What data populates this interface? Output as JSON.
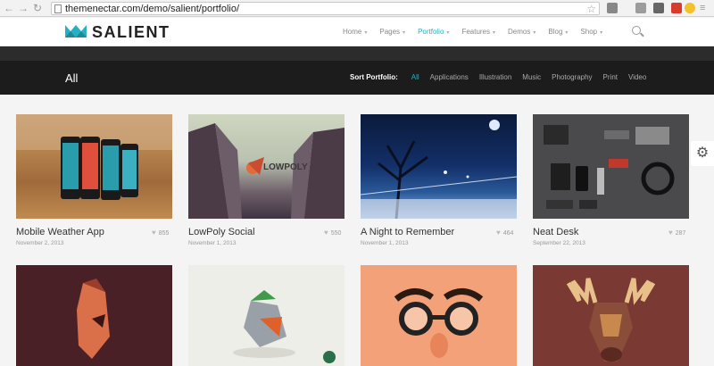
{
  "browser": {
    "url": "themenectar.com/demo/salient/portfolio/"
  },
  "header": {
    "logo_text": "SALIENT",
    "nav": [
      {
        "label": "Home",
        "active": false
      },
      {
        "label": "Pages",
        "active": false
      },
      {
        "label": "Portfolio",
        "active": true
      },
      {
        "label": "Features",
        "active": false
      },
      {
        "label": "Demos",
        "active": false
      },
      {
        "label": "Blog",
        "active": false
      },
      {
        "label": "Shop",
        "active": false
      }
    ]
  },
  "title_bar": {
    "title": "All",
    "sort_label": "Sort Portfolio:",
    "filters": [
      "All",
      "Applications",
      "Illustration",
      "Music",
      "Photography",
      "Print",
      "Video"
    ]
  },
  "items": [
    {
      "title": "Mobile Weather App",
      "date": "November 2, 2013",
      "likes": "855"
    },
    {
      "title": "LowPoly Social",
      "date": "November 1, 2013",
      "likes": "550",
      "image_text": "LOWPOLY"
    },
    {
      "title": "A Night to Remember",
      "date": "November 1, 2013",
      "likes": "464"
    },
    {
      "title": "Neat Desk",
      "date": "September 22, 2013",
      "likes": "287"
    }
  ],
  "colors": {
    "accent": "#27b0c2",
    "title_bar": "#1c1c1c"
  }
}
